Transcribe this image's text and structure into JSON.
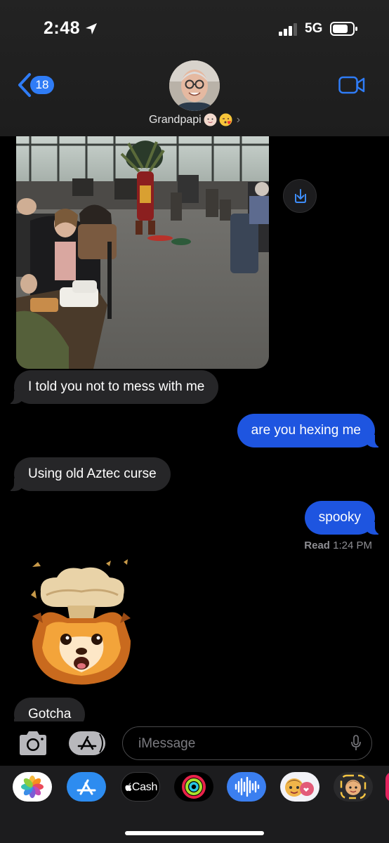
{
  "status_bar": {
    "time": "2:48",
    "network": "5G",
    "icons": [
      "location-arrow-icon",
      "signal-bars-icon",
      "battery-icon"
    ]
  },
  "nav": {
    "back_count": "18",
    "contact_name": "Grandpapi",
    "contact_emojis": [
      "baby-face-emoji",
      "kissing-face-emoji"
    ]
  },
  "messages": [
    {
      "from": "contact",
      "kind": "photo"
    },
    {
      "from": "contact",
      "text": "I told you not to mess with me"
    },
    {
      "from": "me",
      "text": "are you hexing me"
    },
    {
      "from": "contact",
      "text": "Using old Aztec curse"
    },
    {
      "from": "me",
      "text": "spooky"
    },
    {
      "from": "contact",
      "kind": "memoji",
      "icon": "exploding-head-lion-memoji"
    },
    {
      "from": "contact",
      "text": "Gotcha"
    }
  ],
  "read_receipt": {
    "label": "Read",
    "time": "1:24 PM"
  },
  "composer": {
    "placeholder": "iMessage"
  },
  "app_strip": {
    "apps": [
      "photos-app",
      "app-store-app",
      "apple-cash-app",
      "activity-app",
      "audio-message-app",
      "memoji-stickers-app",
      "animoji-app"
    ],
    "cash_label": "Cash"
  },
  "colors": {
    "outgoing_bubble": "#1e55e0",
    "incoming_bubble": "#262628",
    "accent": "#2f7cf6",
    "background": "#000000"
  }
}
